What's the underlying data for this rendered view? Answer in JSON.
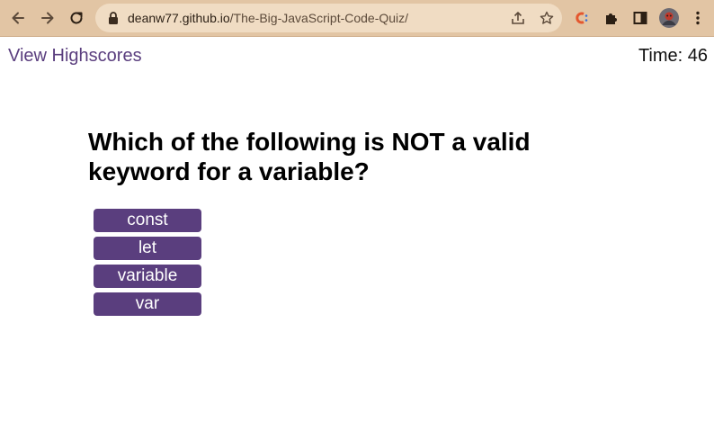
{
  "browser": {
    "url_host": "deanw77.github.io",
    "url_path": "/The-Big-JavaScript-Code-Quiz/",
    "chrome_color": "#e2c5a4",
    "icons": [
      "back-icon",
      "forward-icon",
      "reload-icon",
      "lock-icon",
      "share-icon",
      "star-icon",
      "extension-c-icon",
      "puzzle-icon",
      "sidepanel-icon",
      "profile-avatar",
      "menu-icon"
    ]
  },
  "header": {
    "highscores_link": "View Highscores",
    "timer_label": "Time: 46"
  },
  "quiz": {
    "question": "Which of the following is NOT a valid keyword for a variable?",
    "answers": [
      "const",
      "let",
      "variable",
      "var"
    ],
    "accent_color": "#5a3e7e"
  }
}
